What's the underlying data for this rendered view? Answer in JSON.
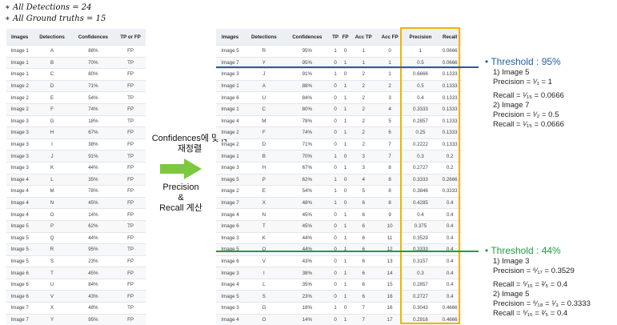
{
  "header": {
    "line1": "∗  All Detections = 24",
    "line2": "∗  All Ground truths = 15"
  },
  "left_table": {
    "columns": [
      "Images",
      "Detections",
      "Confidences",
      "TP or FP"
    ],
    "rows": [
      [
        "Image 1",
        "A",
        "88%",
        "FP"
      ],
      [
        "Image 1",
        "B",
        "70%",
        "TP"
      ],
      [
        "Image 1",
        "C",
        "80%",
        "FP"
      ],
      [
        "Image 2",
        "D",
        "71%",
        "FP"
      ],
      [
        "Image 2",
        "E",
        "54%",
        "TP"
      ],
      [
        "Image 2",
        "F",
        "74%",
        "FP"
      ],
      [
        "Image 3",
        "G",
        "18%",
        "TP"
      ],
      [
        "Image 3",
        "H",
        "67%",
        "FP"
      ],
      [
        "Image 3",
        "I",
        "38%",
        "FP"
      ],
      [
        "Image 3",
        "J",
        "91%",
        "TP"
      ],
      [
        "Image 3",
        "K",
        "44%",
        "FP"
      ],
      [
        "Image 4",
        "L",
        "35%",
        "FP"
      ],
      [
        "Image 4",
        "M",
        "78%",
        "FP"
      ],
      [
        "Image 4",
        "N",
        "45%",
        "FP"
      ],
      [
        "Image 4",
        "O",
        "14%",
        "FP"
      ],
      [
        "Image 5",
        "P",
        "62%",
        "TP"
      ],
      [
        "Image 5",
        "Q",
        "44%",
        "FP"
      ],
      [
        "Image 5",
        "R",
        "95%",
        "TP"
      ],
      [
        "Image 5",
        "S",
        "23%",
        "FP"
      ],
      [
        "Image 6",
        "T",
        "45%",
        "FP"
      ],
      [
        "Image 6",
        "U",
        "84%",
        "FP"
      ],
      [
        "Image 6",
        "V",
        "43%",
        "FP"
      ],
      [
        "Image 7",
        "X",
        "48%",
        "TP"
      ],
      [
        "Image 7",
        "Y",
        "95%",
        "FP"
      ]
    ]
  },
  "arrow": {
    "label_top": "Confidences에 맞춰\n재정렬",
    "label_bottom": "Precision\n&\nRecall 계산",
    "color": "#7cc93f"
  },
  "right_table": {
    "columns": [
      "Images",
      "Detections",
      "Confidences",
      "TP",
      "FP",
      "Acc TP",
      "Acc FP",
      "Precision",
      "Recall"
    ],
    "rows": [
      [
        "Image 5",
        "R",
        "95%",
        "1",
        "0",
        "1",
        "0",
        "1",
        "0.0666"
      ],
      [
        "Image 7",
        "Y",
        "95%",
        "0",
        "1",
        "1",
        "1",
        "0.5",
        "0.0666"
      ],
      [
        "Image 3",
        "J",
        "91%",
        "1",
        "0",
        "2",
        "1",
        "0.6666",
        "0.1333"
      ],
      [
        "Image 1",
        "A",
        "88%",
        "0",
        "1",
        "2",
        "2",
        "0.5",
        "0.1333"
      ],
      [
        "Image 6",
        "U",
        "84%",
        "0",
        "1",
        "2",
        "3",
        "0.4",
        "0.1333"
      ],
      [
        "Image 1",
        "C",
        "80%",
        "0",
        "1",
        "2",
        "4",
        "0.3333",
        "0.1333"
      ],
      [
        "Image 4",
        "M",
        "78%",
        "0",
        "1",
        "2",
        "5",
        "0.2857",
        "0.1333"
      ],
      [
        "Image 2",
        "F",
        "74%",
        "0",
        "1",
        "2",
        "6",
        "0.25",
        "0.1333"
      ],
      [
        "Image 2",
        "D",
        "71%",
        "0",
        "1",
        "2",
        "7",
        "0.2222",
        "0.1333"
      ],
      [
        "Image 1",
        "B",
        "70%",
        "1",
        "0",
        "3",
        "7",
        "0.3",
        "0.2"
      ],
      [
        "Image 3",
        "H",
        "67%",
        "0",
        "1",
        "3",
        "8",
        "0.2727",
        "0.2"
      ],
      [
        "Image 5",
        "P",
        "62%",
        "1",
        "0",
        "4",
        "8",
        "0.3333",
        "0.2666"
      ],
      [
        "Image 2",
        "E",
        "54%",
        "1",
        "0",
        "5",
        "8",
        "0.3846",
        "0.3333"
      ],
      [
        "Image 7",
        "X",
        "48%",
        "1",
        "0",
        "6",
        "8",
        "0.4285",
        "0.4"
      ],
      [
        "Image 4",
        "N",
        "45%",
        "0",
        "1",
        "6",
        "9",
        "0.4",
        "0.4"
      ],
      [
        "Image 6",
        "T",
        "45%",
        "0",
        "1",
        "6",
        "10",
        "0.375",
        "0.4"
      ],
      [
        "Image 3",
        "K",
        "44%",
        "0",
        "1",
        "6",
        "11",
        "0.3529",
        "0.4"
      ],
      [
        "Image 5",
        "Q",
        "44%",
        "0",
        "1",
        "6",
        "12",
        "0.3333",
        "0.4"
      ],
      [
        "Image 6",
        "V",
        "43%",
        "0",
        "1",
        "6",
        "13",
        "0.3157",
        "0.4"
      ],
      [
        "Image 3",
        "I",
        "38%",
        "0",
        "1",
        "6",
        "14",
        "0.3",
        "0.4"
      ],
      [
        "Image 4",
        "L",
        "35%",
        "0",
        "1",
        "6",
        "15",
        "0.2857",
        "0.4"
      ],
      [
        "Image 5",
        "S",
        "23%",
        "0",
        "1",
        "6",
        "16",
        "0.2727",
        "0.4"
      ],
      [
        "Image 3",
        "G",
        "18%",
        "1",
        "0",
        "7",
        "16",
        "0.3043",
        "0.4666"
      ],
      [
        "Image 4",
        "O",
        "14%",
        "0",
        "1",
        "7",
        "17",
        "0.2916",
        "0.4666"
      ]
    ]
  },
  "notes": {
    "threshold95": {
      "title": "Threshold : 95%",
      "color": "#1f5fa8",
      "lines": [
        "1) Image 5",
        "Precision = ¹⁄₁ = 1",
        "Recall = ¹⁄₁₅ = 0.0666",
        "2) Image 7",
        "Precision = ¹⁄₂ = 0.5",
        "Recall = ¹⁄₁₅ = 0.0666"
      ]
    },
    "threshold44": {
      "title": "Threshold : 44%",
      "color": "#1f9e3e",
      "lines": [
        "1) Image 3",
        "Precision = ⁶⁄₁₇ = 0.3529",
        "Recall = ⁶⁄₁₅ = ²⁄₅ = 0.4",
        "2) Image 5",
        "Precision = ⁶⁄₁₈ = ¹⁄₃ = 0.3333",
        "Recall = ⁶⁄₁₅ = ²⁄₅ = 0.4"
      ]
    }
  },
  "colors": {
    "highlight_box": "#f0b400",
    "threshold95_line": "#1f5fa8",
    "threshold44_line": "#1f9e3e"
  }
}
